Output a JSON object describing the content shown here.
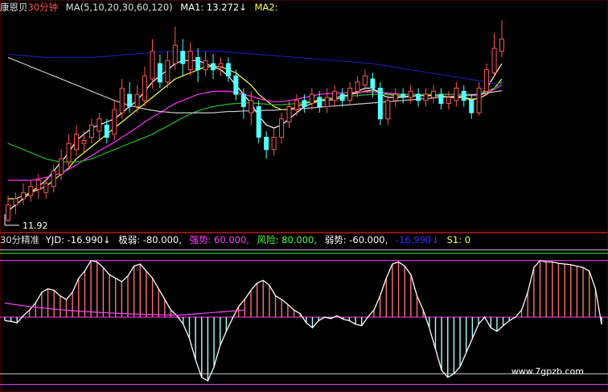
{
  "upper": {
    "stock_name": "康恩贝",
    "period": "30分钟",
    "ma_params": "MA(5,10,20,30,60,120)",
    "ma1": "MA1: 13.272↓",
    "ma2": "MA2:",
    "low_marker": "11.92"
  },
  "lower": {
    "indicator": "30分精准",
    "yjd": "YJD: -16.990↓",
    "jiruo": "极弱: -80.000,",
    "qiangshi": "强势: 60.000,",
    "fengxian": "风险: 80.000,",
    "ruoshi": "弱势: -60.000,",
    "val": "-16.990↓",
    "s1": "S1: 0"
  },
  "watermark": "www.7gpzb.com",
  "colors": {
    "up": "#ff5555",
    "down": "#54ffff",
    "blue": "#1a1aa8",
    "magenta": "#ff30ff",
    "green": "#22bb22",
    "white": "#ffffff",
    "grey": "#c8c8c8",
    "yellow": "#ffff40",
    "pink": "#ff7070"
  },
  "chart_data": {
    "type": "candlestick",
    "price_ylim": [
      11.8,
      15.3
    ],
    "candles": [
      [
        11.95,
        12.2,
        12.35,
        11.92
      ],
      [
        12.2,
        12.3,
        12.4,
        12.05
      ],
      [
        12.3,
        12.4,
        12.55,
        12.2
      ],
      [
        12.35,
        12.5,
        12.6,
        12.25
      ],
      [
        12.45,
        12.6,
        12.7,
        12.3
      ],
      [
        12.4,
        12.55,
        12.65,
        12.3
      ],
      [
        12.5,
        12.75,
        12.85,
        12.4
      ],
      [
        12.7,
        12.95,
        13.1,
        12.6
      ],
      [
        12.9,
        13.2,
        13.35,
        12.8
      ],
      [
        13.1,
        13.35,
        13.5,
        13.0
      ],
      [
        13.2,
        13.25,
        13.4,
        13.05
      ],
      [
        13.3,
        13.5,
        13.6,
        13.2
      ],
      [
        13.4,
        13.6,
        13.7,
        13.25
      ],
      [
        13.5,
        13.3,
        13.6,
        13.2
      ],
      [
        13.35,
        13.75,
        13.9,
        13.25
      ],
      [
        13.7,
        14.1,
        14.25,
        13.6
      ],
      [
        14.0,
        13.8,
        14.2,
        13.7
      ],
      [
        13.8,
        14.0,
        14.15,
        13.7
      ],
      [
        13.9,
        14.3,
        14.45,
        13.8
      ],
      [
        14.25,
        14.7,
        14.9,
        14.1
      ],
      [
        14.5,
        14.2,
        14.65,
        14.1
      ],
      [
        14.2,
        14.55,
        14.7,
        14.1
      ],
      [
        14.5,
        14.8,
        15.1,
        14.4
      ],
      [
        14.7,
        14.5,
        14.9,
        14.3
      ],
      [
        14.4,
        14.7,
        14.85,
        14.3
      ],
      [
        14.6,
        14.4,
        14.75,
        14.2
      ],
      [
        14.4,
        14.55,
        14.7,
        14.3
      ],
      [
        14.5,
        14.4,
        14.65,
        14.25
      ],
      [
        14.45,
        14.5,
        14.6,
        14.3
      ],
      [
        14.5,
        14.3,
        14.6,
        14.2
      ],
      [
        14.3,
        14.0,
        14.4,
        13.9
      ],
      [
        14.0,
        13.8,
        14.1,
        13.6
      ],
      [
        13.7,
        13.9,
        14.05,
        13.5
      ],
      [
        13.8,
        13.3,
        13.9,
        13.2
      ],
      [
        13.3,
        13.1,
        13.4,
        12.95
      ],
      [
        13.1,
        13.3,
        13.45,
        13.0
      ],
      [
        13.3,
        13.6,
        13.7,
        13.2
      ],
      [
        13.55,
        13.8,
        13.9,
        13.45
      ],
      [
        13.75,
        13.9,
        14.0,
        13.65
      ],
      [
        13.9,
        13.8,
        14.0,
        13.7
      ],
      [
        13.85,
        14.0,
        14.1,
        13.75
      ],
      [
        13.95,
        13.8,
        14.05,
        13.7
      ],
      [
        13.8,
        13.95,
        14.1,
        13.7
      ],
      [
        13.9,
        14.05,
        14.15,
        13.8
      ],
      [
        14.0,
        13.9,
        14.1,
        13.8
      ],
      [
        13.9,
        14.1,
        14.2,
        13.85
      ],
      [
        14.05,
        14.2,
        14.3,
        13.95
      ],
      [
        14.15,
        14.3,
        14.4,
        14.05
      ],
      [
        14.25,
        14.1,
        14.35,
        13.95
      ],
      [
        14.1,
        13.6,
        14.2,
        13.5
      ],
      [
        13.6,
        13.9,
        14.0,
        13.5
      ],
      [
        13.9,
        14.0,
        14.1,
        13.8
      ],
      [
        14.0,
        13.95,
        14.1,
        13.85
      ],
      [
        13.95,
        14.05,
        14.15,
        13.85
      ],
      [
        14.0,
        13.9,
        14.1,
        13.8
      ],
      [
        13.9,
        14.0,
        14.1,
        13.8
      ],
      [
        13.95,
        14.05,
        14.15,
        13.85
      ],
      [
        14.0,
        13.85,
        14.1,
        13.75
      ],
      [
        13.85,
        13.95,
        14.05,
        13.75
      ],
      [
        13.9,
        14.1,
        14.2,
        13.8
      ],
      [
        14.05,
        13.9,
        14.15,
        13.8
      ],
      [
        13.9,
        13.7,
        14.0,
        13.6
      ],
      [
        13.7,
        14.1,
        14.2,
        13.65
      ],
      [
        14.05,
        14.4,
        14.5,
        14.0
      ],
      [
        14.35,
        14.75,
        15.0,
        14.3
      ],
      [
        14.7,
        14.9,
        15.2,
        14.6
      ]
    ],
    "ma": [
      {
        "name": "MA1",
        "color": "white",
        "values": [
          12.1,
          12.2,
          12.3,
          12.4,
          12.5,
          12.6,
          12.75,
          12.9,
          13.05,
          13.25,
          13.35,
          13.45,
          13.5,
          13.55,
          13.6,
          13.7,
          13.8,
          13.9,
          14.05,
          14.2,
          14.3,
          14.4,
          14.5,
          14.55,
          14.55,
          14.55,
          14.5,
          14.45,
          14.4,
          14.3,
          14.15,
          14.0,
          13.85,
          13.65,
          13.5,
          13.45,
          13.5,
          13.6,
          13.7,
          13.8,
          13.85,
          13.9,
          13.9,
          13.92,
          13.95,
          14.0,
          14.05,
          14.1,
          14.1,
          14.0,
          13.95,
          13.95,
          13.95,
          13.97,
          13.98,
          13.98,
          13.98,
          13.97,
          13.95,
          13.95,
          13.95,
          13.9,
          13.95,
          14.1,
          14.3,
          14.5
        ]
      },
      {
        "name": "MA2",
        "color": "yellow",
        "values": [
          12.3,
          12.3,
          12.35,
          12.4,
          12.45,
          12.5,
          12.6,
          12.7,
          12.8,
          12.95,
          13.05,
          13.15,
          13.25,
          13.35,
          13.45,
          13.55,
          13.65,
          13.75,
          13.85,
          13.95,
          14.05,
          14.15,
          14.25,
          14.3,
          14.35,
          14.4,
          14.45,
          14.45,
          14.45,
          14.4,
          14.35,
          14.25,
          14.15,
          14.0,
          13.9,
          13.8,
          13.75,
          13.75,
          13.8,
          13.85,
          13.88,
          13.9,
          13.92,
          13.95,
          13.97,
          14.0,
          14.02,
          14.05,
          14.07,
          14.05,
          14.0,
          13.98,
          13.97,
          13.97,
          13.98,
          13.98,
          13.98,
          13.97,
          13.96,
          13.96,
          13.95,
          13.92,
          13.93,
          14.0,
          14.1,
          14.25
        ]
      },
      {
        "name": "MA3",
        "color": "magenta",
        "values": [
          12.6,
          12.6,
          12.6,
          12.6,
          12.62,
          12.65,
          12.68,
          12.72,
          12.78,
          12.85,
          12.93,
          13.0,
          13.08,
          13.15,
          13.22,
          13.3,
          13.38,
          13.46,
          13.55,
          13.63,
          13.7,
          13.78,
          13.85,
          13.9,
          13.95,
          14.0,
          14.02,
          14.05,
          14.05,
          14.05,
          14.03,
          14.0,
          13.97,
          13.93,
          13.9,
          13.88,
          13.88,
          13.9,
          13.92,
          13.95,
          13.97,
          14.0,
          14.01,
          14.02,
          14.02,
          14.03,
          14.03,
          14.04,
          14.04,
          14.03,
          14.02,
          14.01,
          14.0,
          14.0,
          14.0,
          14.0,
          14.0,
          14.0,
          14.0,
          14.0,
          14.0,
          13.98,
          13.98,
          14.02,
          14.08,
          14.15
        ]
      },
      {
        "name": "MA4",
        "color": "green",
        "values": [
          13.2,
          13.15,
          13.1,
          13.05,
          13.0,
          12.95,
          12.92,
          12.9,
          12.9,
          12.9,
          12.92,
          12.95,
          13.0,
          13.05,
          13.1,
          13.15,
          13.2,
          13.25,
          13.3,
          13.35,
          13.42,
          13.48,
          13.55,
          13.62,
          13.68,
          13.73,
          13.77,
          13.8,
          13.82,
          13.84,
          13.85,
          13.86,
          13.86,
          13.85,
          13.84,
          13.83,
          13.83,
          13.84,
          13.85,
          13.87,
          13.89,
          13.91,
          13.93,
          13.95,
          13.96,
          13.97,
          13.98,
          13.99,
          14.0,
          14.0,
          14.0,
          14.0,
          14.0,
          14.0,
          14.0,
          14.0,
          14.0,
          14.0,
          14.0,
          14.0,
          14.0,
          14.0,
          14.0,
          14.05,
          14.1,
          14.2
        ]
      },
      {
        "name": "MA5",
        "color": "grey",
        "values": [
          14.6,
          14.55,
          14.5,
          14.45,
          14.4,
          14.35,
          14.3,
          14.25,
          14.2,
          14.15,
          14.1,
          14.05,
          14.0,
          13.95,
          13.9,
          13.86,
          13.82,
          13.79,
          13.76,
          13.74,
          13.72,
          13.71,
          13.7,
          13.7,
          13.7,
          13.7,
          13.7,
          13.7,
          13.71,
          13.72,
          13.72,
          13.73,
          13.73,
          13.73,
          13.74,
          13.74,
          13.75,
          13.75,
          13.76,
          13.77,
          13.78,
          13.79,
          13.8,
          13.81,
          13.82,
          13.83,
          13.84,
          13.85,
          13.86,
          13.87,
          13.88,
          13.89,
          13.9,
          13.91,
          13.92,
          13.93,
          13.94,
          13.95,
          13.96,
          13.97,
          13.98,
          13.99,
          14.0,
          14.02,
          14.04,
          14.06
        ]
      },
      {
        "name": "MA6",
        "color": "blue",
        "values": [
          14.65,
          14.64,
          14.63,
          14.62,
          14.61,
          14.6,
          14.6,
          14.6,
          14.6,
          14.6,
          14.6,
          14.6,
          14.61,
          14.62,
          14.63,
          14.64,
          14.65,
          14.66,
          14.67,
          14.68,
          14.69,
          14.7,
          14.7,
          14.7,
          14.7,
          14.7,
          14.7,
          14.7,
          14.7,
          14.69,
          14.68,
          14.67,
          14.66,
          14.65,
          14.64,
          14.63,
          14.62,
          14.61,
          14.6,
          14.59,
          14.58,
          14.57,
          14.56,
          14.55,
          14.54,
          14.53,
          14.52,
          14.51,
          14.5,
          14.48,
          14.46,
          14.44,
          14.42,
          14.4,
          14.38,
          14.36,
          14.34,
          14.32,
          14.3,
          14.28,
          14.26,
          14.24,
          14.22,
          14.2,
          14.18,
          14.16
        ]
      }
    ],
    "osc_ylim": [
      -100,
      100
    ],
    "yjd": [
      -5,
      -6,
      -8,
      2,
      10,
      20,
      35,
      40,
      38,
      30,
      25,
      35,
      55,
      65,
      80,
      78,
      70,
      60,
      55,
      50,
      58,
      72,
      75,
      65,
      55,
      40,
      25,
      10,
      2,
      -10,
      -30,
      -60,
      -85,
      -90,
      -70,
      -40,
      -20,
      -2,
      15,
      25,
      38,
      48,
      52,
      45,
      30,
      25,
      18,
      10,
      5,
      -8,
      -15,
      -5,
      0,
      -2,
      2,
      -3,
      -5,
      -10,
      -12,
      0,
      10,
      30,
      55,
      75,
      78,
      72,
      60,
      30,
      10,
      -15,
      -45,
      -75,
      -85,
      -80,
      -70,
      -50,
      -30,
      -10,
      0,
      -15,
      -20,
      -12,
      -5,
      0,
      10,
      35,
      70,
      80,
      78,
      78,
      76,
      75,
      74,
      72,
      70,
      65,
      40,
      -10
    ]
  }
}
